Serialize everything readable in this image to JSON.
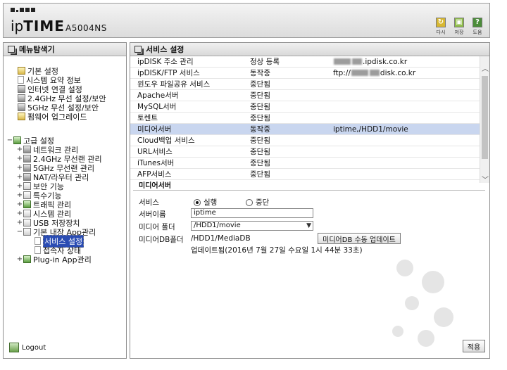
{
  "header": {
    "brand": "ipTIME",
    "model": "A5004NS",
    "buttons": [
      {
        "label": "다시",
        "icon": "refresh-icon"
      },
      {
        "label": "저장",
        "icon": "save-icon"
      },
      {
        "label": "도움",
        "icon": "help-icon"
      }
    ]
  },
  "sidebar": {
    "title": "메뉴탐색기",
    "basic_group": "기본 설정",
    "basic_items": [
      "시스템 요약 정보",
      "인터넷 연결 설정",
      "2.4GHz 무선 설정/보안",
      "5GHz 무선 설정/보안",
      "펌웨어 업그레이드"
    ],
    "advanced_group": "고급 설정",
    "advanced_items": [
      "네트워크 관리",
      "2.4GHz 무선랜 관리",
      "5GHz 무선랜 관리",
      "NAT/라우터 관리",
      "보안 기능",
      "특수기능",
      "트래픽 관리",
      "시스템 관리",
      "USB 저장장치",
      "기본 내장 App관리"
    ],
    "app_children": [
      "서비스 설정",
      "접속자 상태"
    ],
    "plugin_item": "Plug-in App관리",
    "logout": "Logout"
  },
  "main": {
    "title": "서비스 설정",
    "services": [
      {
        "name": "ipDISK 주소 관리",
        "status": "정상 등록",
        "info_suffix": ".ipdisk.co.kr"
      },
      {
        "name": "ipDISK/FTP 서비스",
        "status": "동작중",
        "info_prefix": "ftp://",
        "info_suffix": "disk.co.kr"
      },
      {
        "name": "윈도우 파일공유 서비스",
        "status": "중단됨",
        "info": ""
      },
      {
        "name": "Apache서버",
        "status": "중단됨",
        "info": ""
      },
      {
        "name": "MySQL서버",
        "status": "중단됨",
        "info": ""
      },
      {
        "name": "토렌트",
        "status": "중단됨",
        "info": ""
      },
      {
        "name": "미디어서버",
        "status": "동작중",
        "info": "iptime,/HDD1/movie"
      },
      {
        "name": "Cloud백업 서비스",
        "status": "중단됨",
        "info": ""
      },
      {
        "name": "URL서비스",
        "status": "중단됨",
        "info": ""
      },
      {
        "name": "iTunes서버",
        "status": "중단됨",
        "info": ""
      },
      {
        "name": "AFP서비스",
        "status": "중단됨",
        "info": ""
      }
    ],
    "section": "미디어서버",
    "form": {
      "service_label": "서비스",
      "run_label": "실행",
      "stop_label": "중단",
      "server_name_label": "서버이름",
      "server_name_value": "iptime",
      "media_folder_label": "미디어 폴더",
      "media_folder_value": "/HDD1/movie",
      "db_folder_label": "미디어DB폴더",
      "db_folder_value": "/HDD1/MediaDB",
      "db_update_button": "미디어DB 수동 업데이트",
      "update_text": "업데이트됨(2016년 7월 27일 수요일 1시 44분 33초)"
    },
    "apply_button": "적용"
  }
}
